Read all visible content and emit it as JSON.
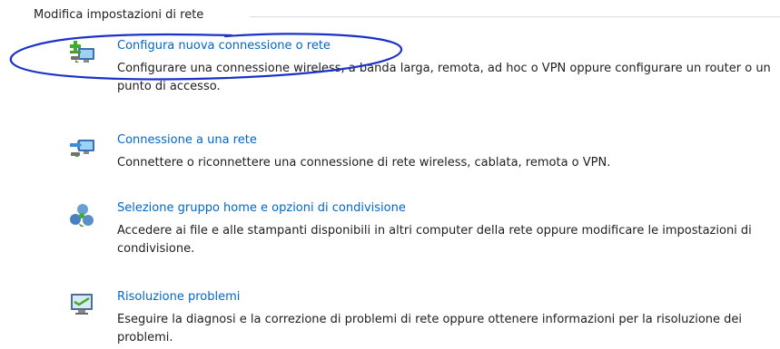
{
  "section": {
    "title": "Modifica impostazioni di rete"
  },
  "tasks": [
    {
      "icon": "new-connection-icon",
      "link": "Configura nuova connessione o rete",
      "description": "Configurare una connessione wireless, a banda larga, remota, ad hoc o VPN oppure configurare un router o un punto di accesso."
    },
    {
      "icon": "connect-network-icon",
      "link": "Connessione a una rete",
      "description": "Connettere o riconnettere una connessione di rete wireless, cablata, remota o VPN."
    },
    {
      "icon": "homegroup-icon",
      "link": "Selezione gruppo home e opzioni di condivisione",
      "description": "Accedere ai file e alle stampanti disponibili in altri computer della rete oppure modificare le impostazioni di condivisione."
    },
    {
      "icon": "troubleshoot-icon",
      "link": "Risoluzione problemi",
      "description": "Eseguire la diagnosi e la correzione di problemi di rete oppure ottenere informazioni per la risoluzione dei problemi."
    }
  ],
  "colors": {
    "link": "#0066cc",
    "annotation": "#1a32c8",
    "divider": "#d5dfe5"
  }
}
